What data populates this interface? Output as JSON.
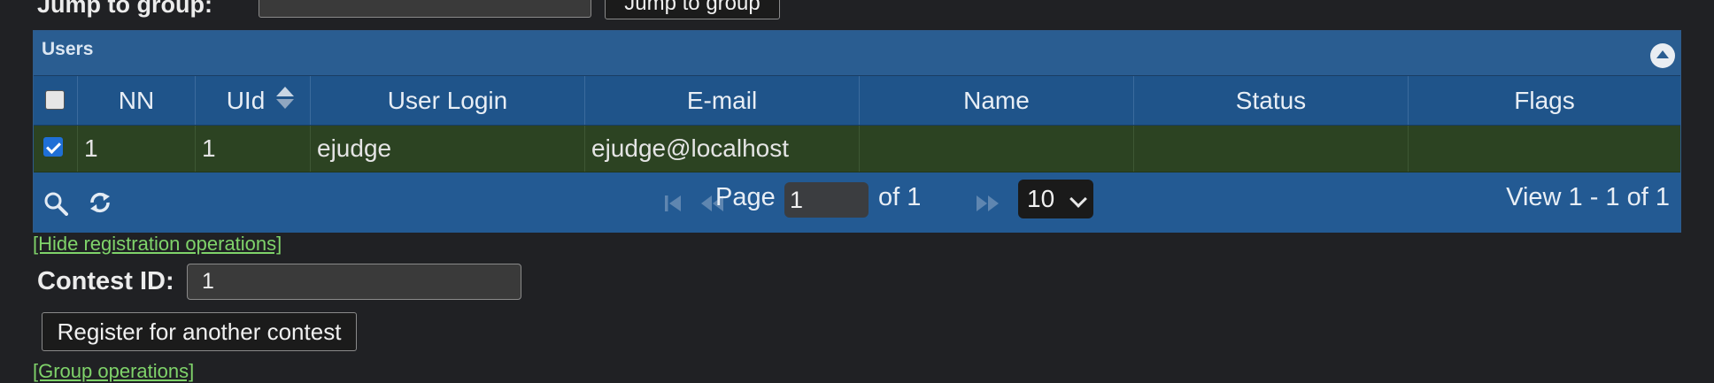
{
  "jump": {
    "label": "Jump to group:",
    "input_value": "",
    "button_label": "Jump to group"
  },
  "grid": {
    "caption": "Users",
    "columns": [
      "NN",
      "UId",
      "User Login",
      "E-mail",
      "Name",
      "Status",
      "Flags"
    ],
    "rows": [
      {
        "checked": true,
        "nn": "1",
        "uid": "1",
        "login": "ejudge",
        "email": "ejudge@localhost",
        "name": "",
        "status": "",
        "flags": ""
      }
    ],
    "pager": {
      "page_label": "Page",
      "page_value": "1",
      "of_label": "of 1",
      "rows_per_page": "10",
      "view_text": "View 1 - 1 of 1"
    }
  },
  "links": {
    "hide_registration": "[Hide registration operations]",
    "group_operations": "[Group operations]"
  },
  "contest": {
    "label": "Contest ID:",
    "value": "1",
    "register_button": "Register for another contest"
  },
  "colors": {
    "header_bg": "#1f548a",
    "row_selected_bg": "#2c4322",
    "link": "#7fd36a",
    "page_bg": "#202124"
  }
}
